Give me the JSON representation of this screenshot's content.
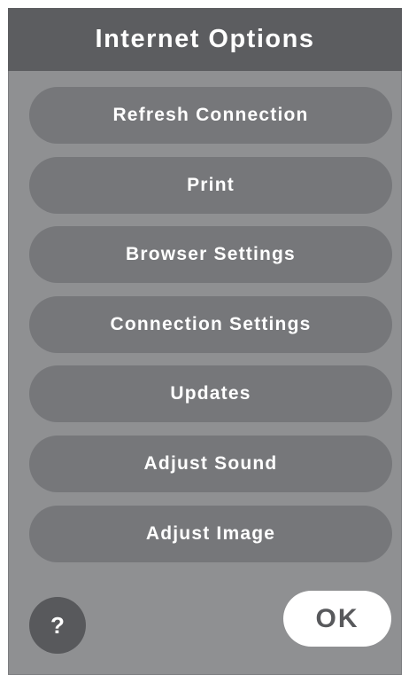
{
  "dialog": {
    "title": "Internet Options",
    "menu_items": [
      {
        "label": "Refresh Connection"
      },
      {
        "label": "Print"
      },
      {
        "label": "Browser Settings"
      },
      {
        "label": "Connection Settings"
      },
      {
        "label": "Updates"
      },
      {
        "label": "Adjust Sound"
      },
      {
        "label": "Adjust Image"
      }
    ],
    "help_label": "?",
    "ok_label": "OK"
  },
  "colors": {
    "panel_background": "#8f9092",
    "title_bar": "#5c5d60",
    "menu_button": "#76777a",
    "help_button": "#58595c",
    "ok_button": "#ffffff",
    "text_primary": "#ffffff",
    "ok_text": "#58595c"
  }
}
